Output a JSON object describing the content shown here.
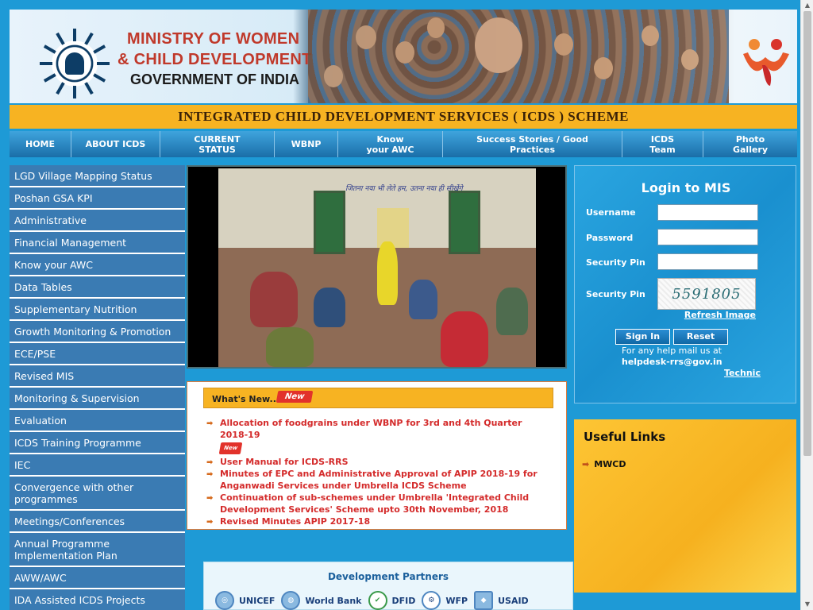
{
  "header": {
    "ministry_line1": "MINISTRY OF WOMEN",
    "ministry_line2": "& CHILD DEVELOPMENT",
    "ministry_line3": "GOVERNMENT OF INDIA"
  },
  "banner": {
    "title": "INTEGRATED CHILD DEVELOPMENT SERVICES ( ICDS ) SCHEME"
  },
  "nav": {
    "items": [
      {
        "label": "HOME"
      },
      {
        "label": "ABOUT ICDS"
      },
      {
        "label": "CURRENT STATUS"
      },
      {
        "label": "WBNP"
      },
      {
        "label": "Know your AWC"
      },
      {
        "label": "Success Stories / Good Practices"
      },
      {
        "label": "ICDS Team"
      },
      {
        "label": "Photo Gallery"
      }
    ]
  },
  "sidebar": {
    "items": [
      {
        "label": "LGD Village Mapping Status"
      },
      {
        "label": "Poshan GSA KPI"
      },
      {
        "label": "Administrative"
      },
      {
        "label": "Financial Management"
      },
      {
        "label": "Know your AWC"
      },
      {
        "label": "Data Tables"
      },
      {
        "label": "Supplementary Nutrition"
      },
      {
        "label": "Growth Monitoring & Promotion"
      },
      {
        "label": "ECE/PSE"
      },
      {
        "label": "Revised MIS"
      },
      {
        "label": "Monitoring & Supervision"
      },
      {
        "label": "Evaluation"
      },
      {
        "label": "ICDS Training Programme"
      },
      {
        "label": "IEC"
      },
      {
        "label": "Convergence with other programmes"
      },
      {
        "label": "Meetings/Conferences"
      },
      {
        "label": "Annual Programme Implementation Plan"
      },
      {
        "label": "AWW/AWC"
      },
      {
        "label": "IDA Assisted ICDS Projects"
      }
    ]
  },
  "news": {
    "heading": "What's New...",
    "badge": "New",
    "items": [
      {
        "text": "Allocation of foodgrains under WBNP for 3rd and 4th Quarter 2018-19",
        "badge": "New"
      },
      {
        "text": "User Manual for ICDS-RRS"
      },
      {
        "text": "Minutes of EPC and Administrative Approval of APIP 2018-19 for Anganwadi Services under Umbrella ICDS Scheme"
      },
      {
        "text": "Continuation of sub-schemes under Umbrella 'Integrated Child Development Services' Scheme upto 30th November, 2018"
      },
      {
        "text": "Revised Minutes APIP 2017-18"
      }
    ]
  },
  "partners": {
    "title": "Development Partners",
    "items": [
      {
        "name": "UNICEF",
        "icon": "un-emblem-icon"
      },
      {
        "name": "World Bank",
        "icon": "globe-icon"
      },
      {
        "name": "DFID",
        "icon": "check-icon"
      },
      {
        "name": "WFP",
        "icon": "gear-icon"
      },
      {
        "name": "USAID",
        "icon": "shield-icon"
      }
    ]
  },
  "login": {
    "title": "Login to MIS",
    "username_label": "Username",
    "password_label": "Password",
    "security_pin_label": "Security Pin",
    "captcha_label": "Security Pin",
    "captcha_text": "5591805",
    "refresh_label": "Refresh Image",
    "signin_label": "Sign In",
    "reset_label": "Reset",
    "help_text": "For any help mail us at",
    "help_email": "helpdesk-rrs@gov.in",
    "marquee_text": "Technic"
  },
  "useful_links": {
    "title": "Useful Links",
    "items": [
      {
        "label": "MWCD"
      }
    ]
  },
  "slide": {
    "hindi_caption": "जितना नया भी लेते हम, उतना नया ही सीखेंगे"
  },
  "colors": {
    "accent_blue": "#1e9ad6",
    "nav_blue": "#1a6ea8",
    "banner_yellow": "#f7b322",
    "sidebar_blue": "#3a7bb3",
    "news_red": "#d42b2b"
  }
}
